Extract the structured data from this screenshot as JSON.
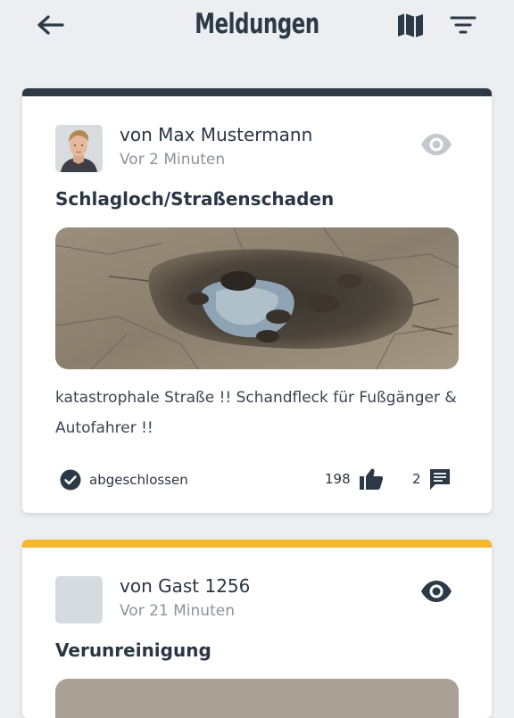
{
  "header": {
    "title": "Meldungen",
    "back_icon": "arrow-left-icon",
    "map_icon": "map-icon",
    "filter_icon": "filter-icon"
  },
  "colors": {
    "background": "#eceef1",
    "text_dark": "#2b3644",
    "text_muted": "#8a939c",
    "strip_done": "#2f3a45",
    "strip_open": "#f5b72b"
  },
  "reports": [
    {
      "author": "von Max Mustermann",
      "time": "Vor 2 Minuten",
      "category": "Schlagloch/Straßenschaden",
      "description": "katastrophale Straße !! Schandfleck für Fußgänger & Autofahrer !!",
      "status": "abgeschlossen",
      "likes": "198",
      "comments": "2",
      "avatar": "user-photo",
      "photo": "pothole-photo",
      "watch_icon": "eye-icon"
    },
    {
      "author": "von Gast 1256",
      "time": "Vor 21 Minuten",
      "category": "Verunreinigung",
      "avatar": "placeholder-avatar",
      "watch_icon": "eye-icon"
    }
  ]
}
